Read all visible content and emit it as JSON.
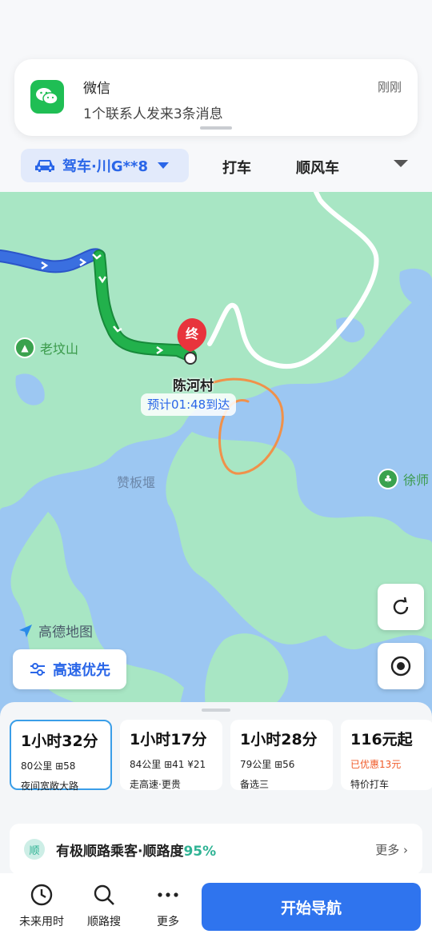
{
  "notification": {
    "app_name": "微信",
    "message": "1个联系人发来3条消息",
    "time": "刚刚"
  },
  "modes": {
    "selected": "驾车·川G**8",
    "tab_taxi": "打车",
    "tab_carpool": "顺风车"
  },
  "map": {
    "poi_left": "老坟山",
    "poi_right": "徐师",
    "destination_marker": "终",
    "destination_name": "陈河村",
    "eta": "预计01:48到达",
    "water_label": "赞板堰",
    "logo": "高德地图",
    "highway_pref": "高速优先"
  },
  "routes": [
    {
      "time": "1小时32分",
      "meta": "80公里 ⊞58",
      "tag": "夜间宽敞大路",
      "selected": true
    },
    {
      "time": "1小时17分",
      "meta": "84公里 ⊞41 ¥21",
      "tag": "走高速·更贵",
      "selected": false
    },
    {
      "time": "1小时28分",
      "meta": "79公里 ⊞56",
      "tag": "备选三",
      "selected": false
    },
    {
      "time": "116元起",
      "promo": "已优惠13元",
      "tag": "特价打车",
      "selected": false
    }
  ],
  "suggest": {
    "badge": "顺",
    "text": "有极顺路乘客·顺路度",
    "percent": "95%",
    "more": "更多"
  },
  "bottom": {
    "future": "未来用时",
    "along_search": "顺路搜",
    "more": "更多",
    "start": "开始导航"
  },
  "colors": {
    "accent": "#2f74ee",
    "route_green": "#22b14c",
    "route_blue": "#3a6fe0",
    "water": "#9cc7f2",
    "land": "#a8e6c4"
  }
}
